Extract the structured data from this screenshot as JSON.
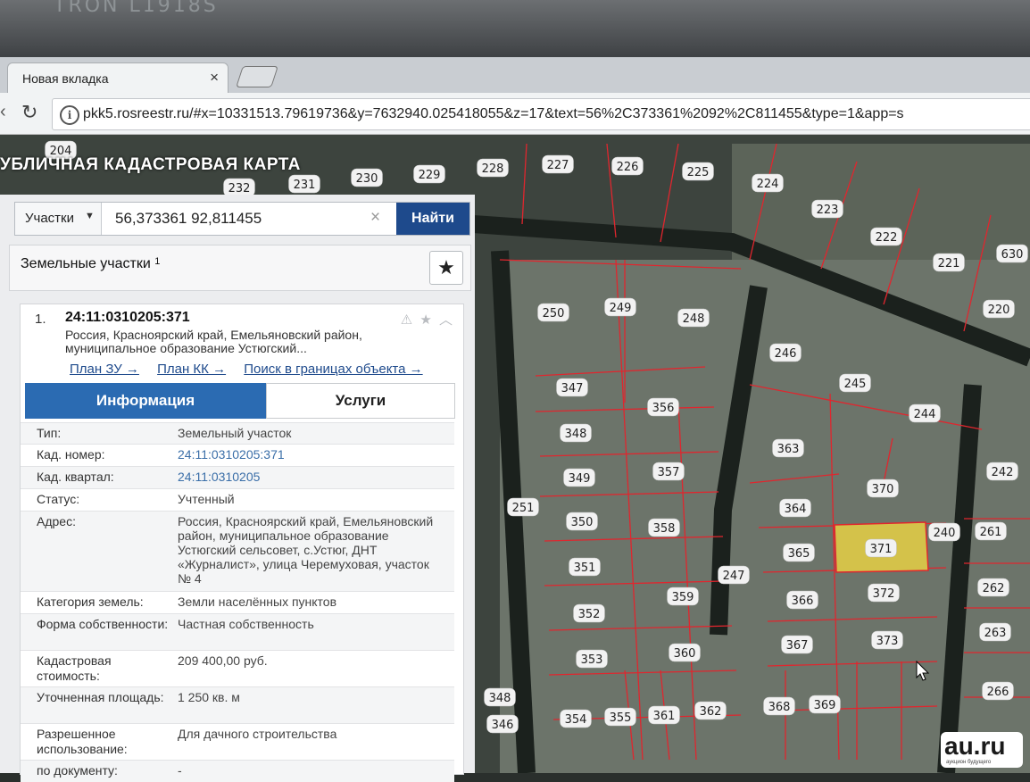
{
  "monitor": {
    "brand": "TRON L1918S"
  },
  "browser": {
    "tab_title": "Новая вкладка",
    "tab_close": "×",
    "url": "pkk5.rosreestr.ru/#x=10331513.79619736&y=7632940.025418055&z=17&text=56%2C373361%2092%2C811455&type=1&app=s"
  },
  "map": {
    "title": "УБЛИЧНАЯ КАДАСТРОВАЯ КАРТА",
    "highlight_color": "#d4c24a",
    "boundary_color": "#e0262e",
    "labels": [
      "204",
      "232",
      "231",
      "230",
      "229",
      "228",
      "227",
      "226",
      "225",
      "224",
      "223",
      "222",
      "221",
      "630",
      "220",
      "250",
      "249",
      "248",
      "246",
      "245",
      "244",
      "347",
      "356",
      "348",
      "363",
      "370",
      "349",
      "357",
      "242",
      "364",
      "350",
      "358",
      "251",
      "365",
      "371",
      "240",
      "261",
      "351",
      "247",
      "366",
      "372",
      "262",
      "352",
      "359",
      "367",
      "373",
      "263",
      "353",
      "360",
      "368",
      "369",
      "266",
      "354",
      "355",
      "361",
      "362",
      "348",
      "346"
    ]
  },
  "panel": {
    "search": {
      "type_label": "Участки",
      "query": "56,373361 92,811455",
      "clear": "×",
      "find_label": "Найти"
    },
    "list": {
      "title": "Земельные участки",
      "count": "1"
    },
    "result": {
      "index": "1.",
      "cad_number": "24:11:0310205:371",
      "address_short": "Россия, Красноярский край, Емельяновский район, муниципальное образование Устюгский...",
      "links": [
        "План ЗУ →",
        "План КК →",
        "Поиск в границах объекта →"
      ],
      "tab_info": "Информация",
      "tab_services": "Услуги",
      "fields": [
        {
          "k": "Тип:",
          "v": "Земельный участок"
        },
        {
          "k": "Кад. номер:",
          "v": "24:11:0310205:371"
        },
        {
          "k": "Кад. квартал:",
          "v": "24:11:0310205"
        },
        {
          "k": "Статус:",
          "v": "Учтенный"
        },
        {
          "k": "Адрес:",
          "v": "Россия, Красноярский край, Емельяновский район, муниципальное образование Устюгский сельсовет, с.Устюг, ДНТ «Журналист», улица Черемуховая, участок № 4"
        },
        {
          "k": "Категория земель:",
          "v": "Земли населённых пунктов"
        },
        {
          "k": "Форма собственности:",
          "v": "Частная собственность"
        },
        {
          "k": "Кадастровая стоимость:",
          "v": "209 400,00 руб."
        },
        {
          "k": "Уточненная площадь:",
          "v": "1 250 кв. м"
        },
        {
          "k": "Разрешенное использование:",
          "v": "Для дачного строительства"
        },
        {
          "k": "по документу:",
          "v": "-"
        }
      ]
    }
  },
  "watermark": {
    "text": "au.ru",
    "sub": "аукцион будущего"
  }
}
